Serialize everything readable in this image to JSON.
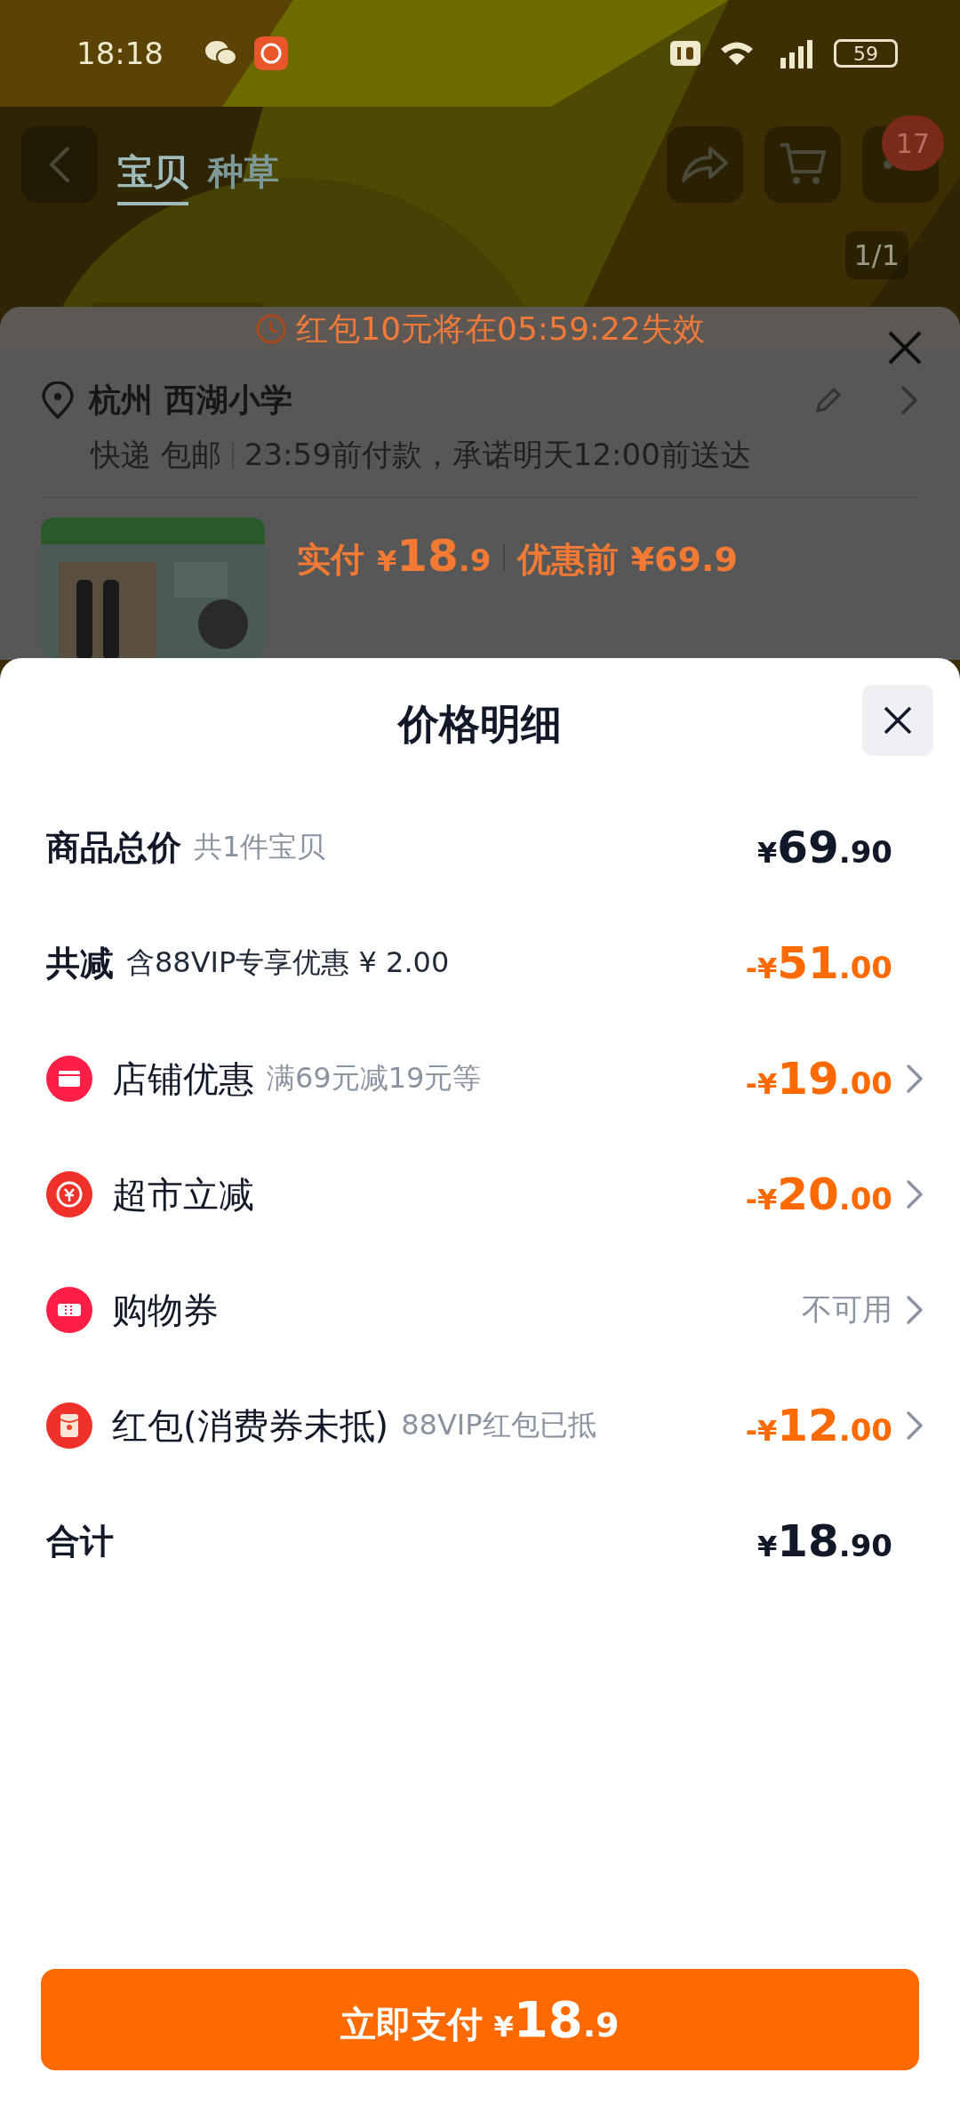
{
  "status_bar": {
    "time": "18:18",
    "battery": "59"
  },
  "header": {
    "tabs": [
      {
        "label": "宝贝",
        "selected": true
      },
      {
        "label": "种草",
        "selected": false
      }
    ],
    "badge": "17",
    "counter": "1/1"
  },
  "order_sheet": {
    "timer": "红包10元将在05:59:22失效",
    "address": "杭州 西湖小学",
    "shipping": "快递 包邮",
    "delivery": "23:59前付款，承诺明天12:00前送达",
    "paid_label": "实付",
    "paid": {
      "prefix": "¥",
      "int": "18",
      "dec": ".9"
    },
    "before": "优惠前 ¥69.9"
  },
  "price_sheet": {
    "title": "价格明细",
    "rows": [
      {
        "kind": "summary",
        "label": "商品总价",
        "note": "共1件宝贝",
        "amount": {
          "prefix": "¥",
          "int": "69",
          "dec": ".90"
        },
        "discount": false,
        "link": false
      },
      {
        "kind": "summary",
        "label": "共减",
        "note": "含88VIP专享优惠 ¥ 2.00",
        "amount": {
          "prefix": "-¥",
          "int": "51",
          "dec": ".00"
        },
        "discount": true,
        "link": false
      },
      {
        "kind": "item",
        "label": "店铺优惠",
        "note": "满69元减19元等",
        "amount": {
          "prefix": "-¥",
          "int": "19",
          "dec": ".00"
        },
        "discount": true,
        "link": true
      },
      {
        "kind": "item",
        "label": "超市立减",
        "amount": {
          "prefix": "-¥",
          "int": "20",
          "dec": ".00"
        },
        "discount": true,
        "link": true
      },
      {
        "kind": "item",
        "label": "购物券",
        "status": "不可用",
        "discount": false,
        "link": true
      },
      {
        "kind": "item",
        "label": "红包(消费券未抵)",
        "note": "88VIP红包已抵",
        "amount": {
          "prefix": "-¥",
          "int": "12",
          "dec": ".00"
        },
        "discount": true,
        "link": true
      },
      {
        "kind": "summary",
        "label": "合计",
        "amount": {
          "prefix": "¥",
          "int": "18",
          "dec": ".90"
        },
        "discount": false,
        "link": false
      }
    ],
    "pay_button": {
      "label": "立即支付",
      "amount": {
        "prefix": "¥",
        "int": "18",
        "dec": ".9"
      }
    }
  }
}
